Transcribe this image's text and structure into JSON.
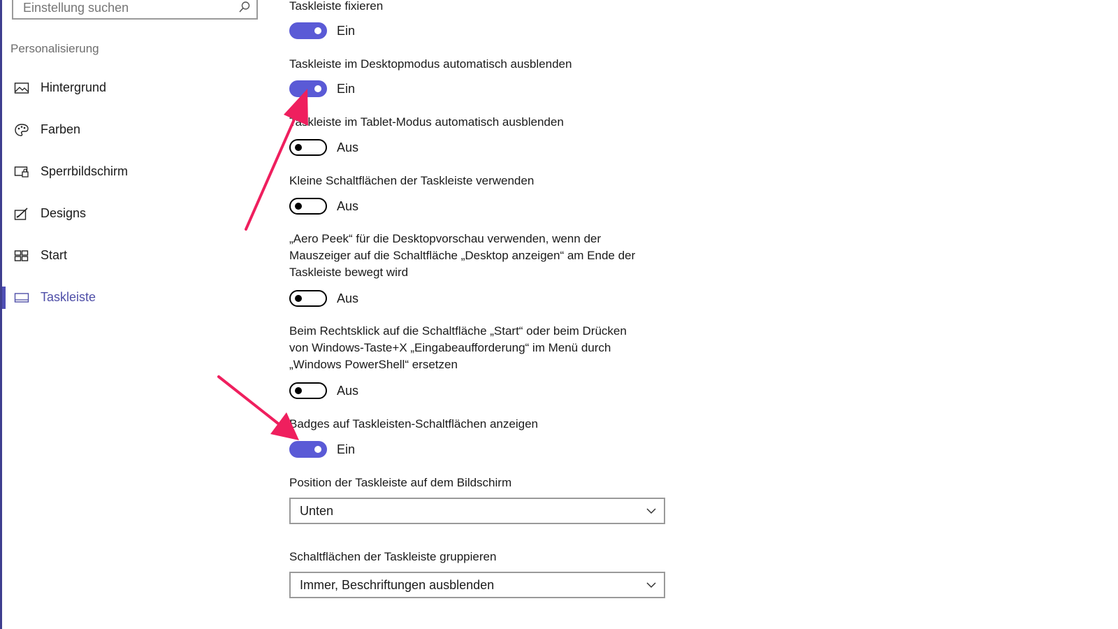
{
  "accent_color": "#5a5ad6",
  "arrow_color": "#ef1f5e",
  "sidebar": {
    "search_placeholder": "Einstellung suchen",
    "section_title": "Personalisierung",
    "items": [
      {
        "label": "Hintergrund",
        "icon": "image-icon"
      },
      {
        "label": "Farben",
        "icon": "palette-icon"
      },
      {
        "label": "Sperrbildschirm",
        "icon": "lockscreen-icon"
      },
      {
        "label": "Designs",
        "icon": "designs-icon"
      },
      {
        "label": "Start",
        "icon": "start-icon"
      },
      {
        "label": "Taskleiste",
        "icon": "taskbar-icon",
        "selected": true
      }
    ]
  },
  "settings": {
    "lock": {
      "label": "Taskleiste fixieren",
      "state": "Ein",
      "on": true
    },
    "autohide_desktop": {
      "label": "Taskleiste im Desktopmodus automatisch ausblenden",
      "state": "Ein",
      "on": true
    },
    "autohide_tablet": {
      "label": "Taskleiste im Tablet-Modus automatisch ausblenden",
      "state": "Aus",
      "on": false
    },
    "small_buttons": {
      "label": "Kleine Schaltflächen der Taskleiste verwenden",
      "state": "Aus",
      "on": false
    },
    "aero_peek": {
      "label_lines": [
        "„Aero Peek“ für die Desktopvorschau verwenden, wenn der",
        "Mauszeiger auf die Schaltfläche „Desktop anzeigen“ am Ende der",
        "Taskleiste bewegt wird"
      ],
      "state": "Aus",
      "on": false
    },
    "powershell": {
      "label_lines": [
        "Beim Rechtsklick auf die Schaltfläche „Start“ oder beim Drücken",
        "von Windows-Taste+X „Eingabeaufforderung“ im Menü durch",
        "„Windows PowerShell“ ersetzen"
      ],
      "state": "Aus",
      "on": false
    },
    "badges": {
      "label": "Badges auf Taskleisten-Schaltflächen anzeigen",
      "state": "Ein",
      "on": true
    },
    "position": {
      "label": "Position der Taskleiste auf dem Bildschirm",
      "value": "Unten"
    },
    "combine": {
      "label": "Schaltflächen der Taskleiste gruppieren",
      "value": "Immer, Beschriftungen ausblenden"
    }
  }
}
